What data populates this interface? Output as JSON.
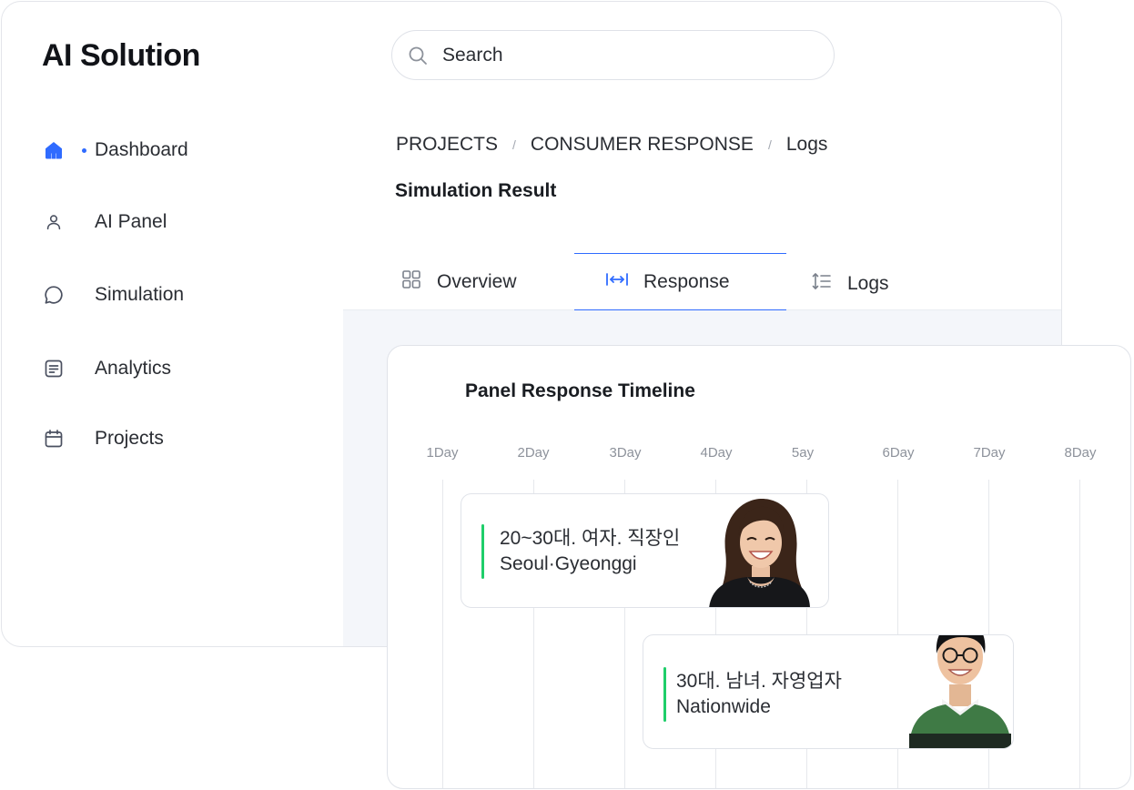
{
  "app": {
    "title": "AI Solution"
  },
  "search": {
    "placeholder": "Search"
  },
  "sidebar": {
    "items": [
      {
        "label": "Dashboard",
        "icon": "home-icon",
        "active": true
      },
      {
        "label": "AI Panel",
        "icon": "user-icon",
        "active": false
      },
      {
        "label": "Simulation",
        "icon": "chat-bubble-icon",
        "active": false
      },
      {
        "label": "Analytics",
        "icon": "document-icon",
        "active": false
      },
      {
        "label": "Projects",
        "icon": "calendar-icon",
        "active": false
      }
    ]
  },
  "breadcrumb": {
    "items": [
      "PROJECTS",
      "CONSUMER RESPONSE",
      "Logs"
    ],
    "separator": "/"
  },
  "page": {
    "title": "Simulation Result"
  },
  "tabs": [
    {
      "label": "Overview",
      "icon": "grid-icon",
      "active": false
    },
    {
      "label": "Response",
      "icon": "expand-horizontal-icon",
      "active": true
    },
    {
      "label": "Logs",
      "icon": "sort-list-icon",
      "active": false
    }
  ],
  "timeline": {
    "title": "Panel Response Timeline",
    "days": [
      "1Day",
      "2Day",
      "3Day",
      "4Day",
      "5ay",
      "6Day",
      "7Day",
      "8Day"
    ],
    "events": [
      {
        "line1": "20~30대. 여자. 직장인",
        "line2": "Seoul·Gyeonggi",
        "avatar": "smiling-woman-avatar"
      },
      {
        "line1": "30대. 남녀. 자영업자",
        "line2": "Nationwide",
        "avatar": "smiling-man-with-glasses-avatar"
      }
    ]
  },
  "colors": {
    "accent": "#2f6bff",
    "event_marker": "#1fce6a",
    "content_background": "#f4f6fa",
    "border": "#e0e3e9"
  }
}
